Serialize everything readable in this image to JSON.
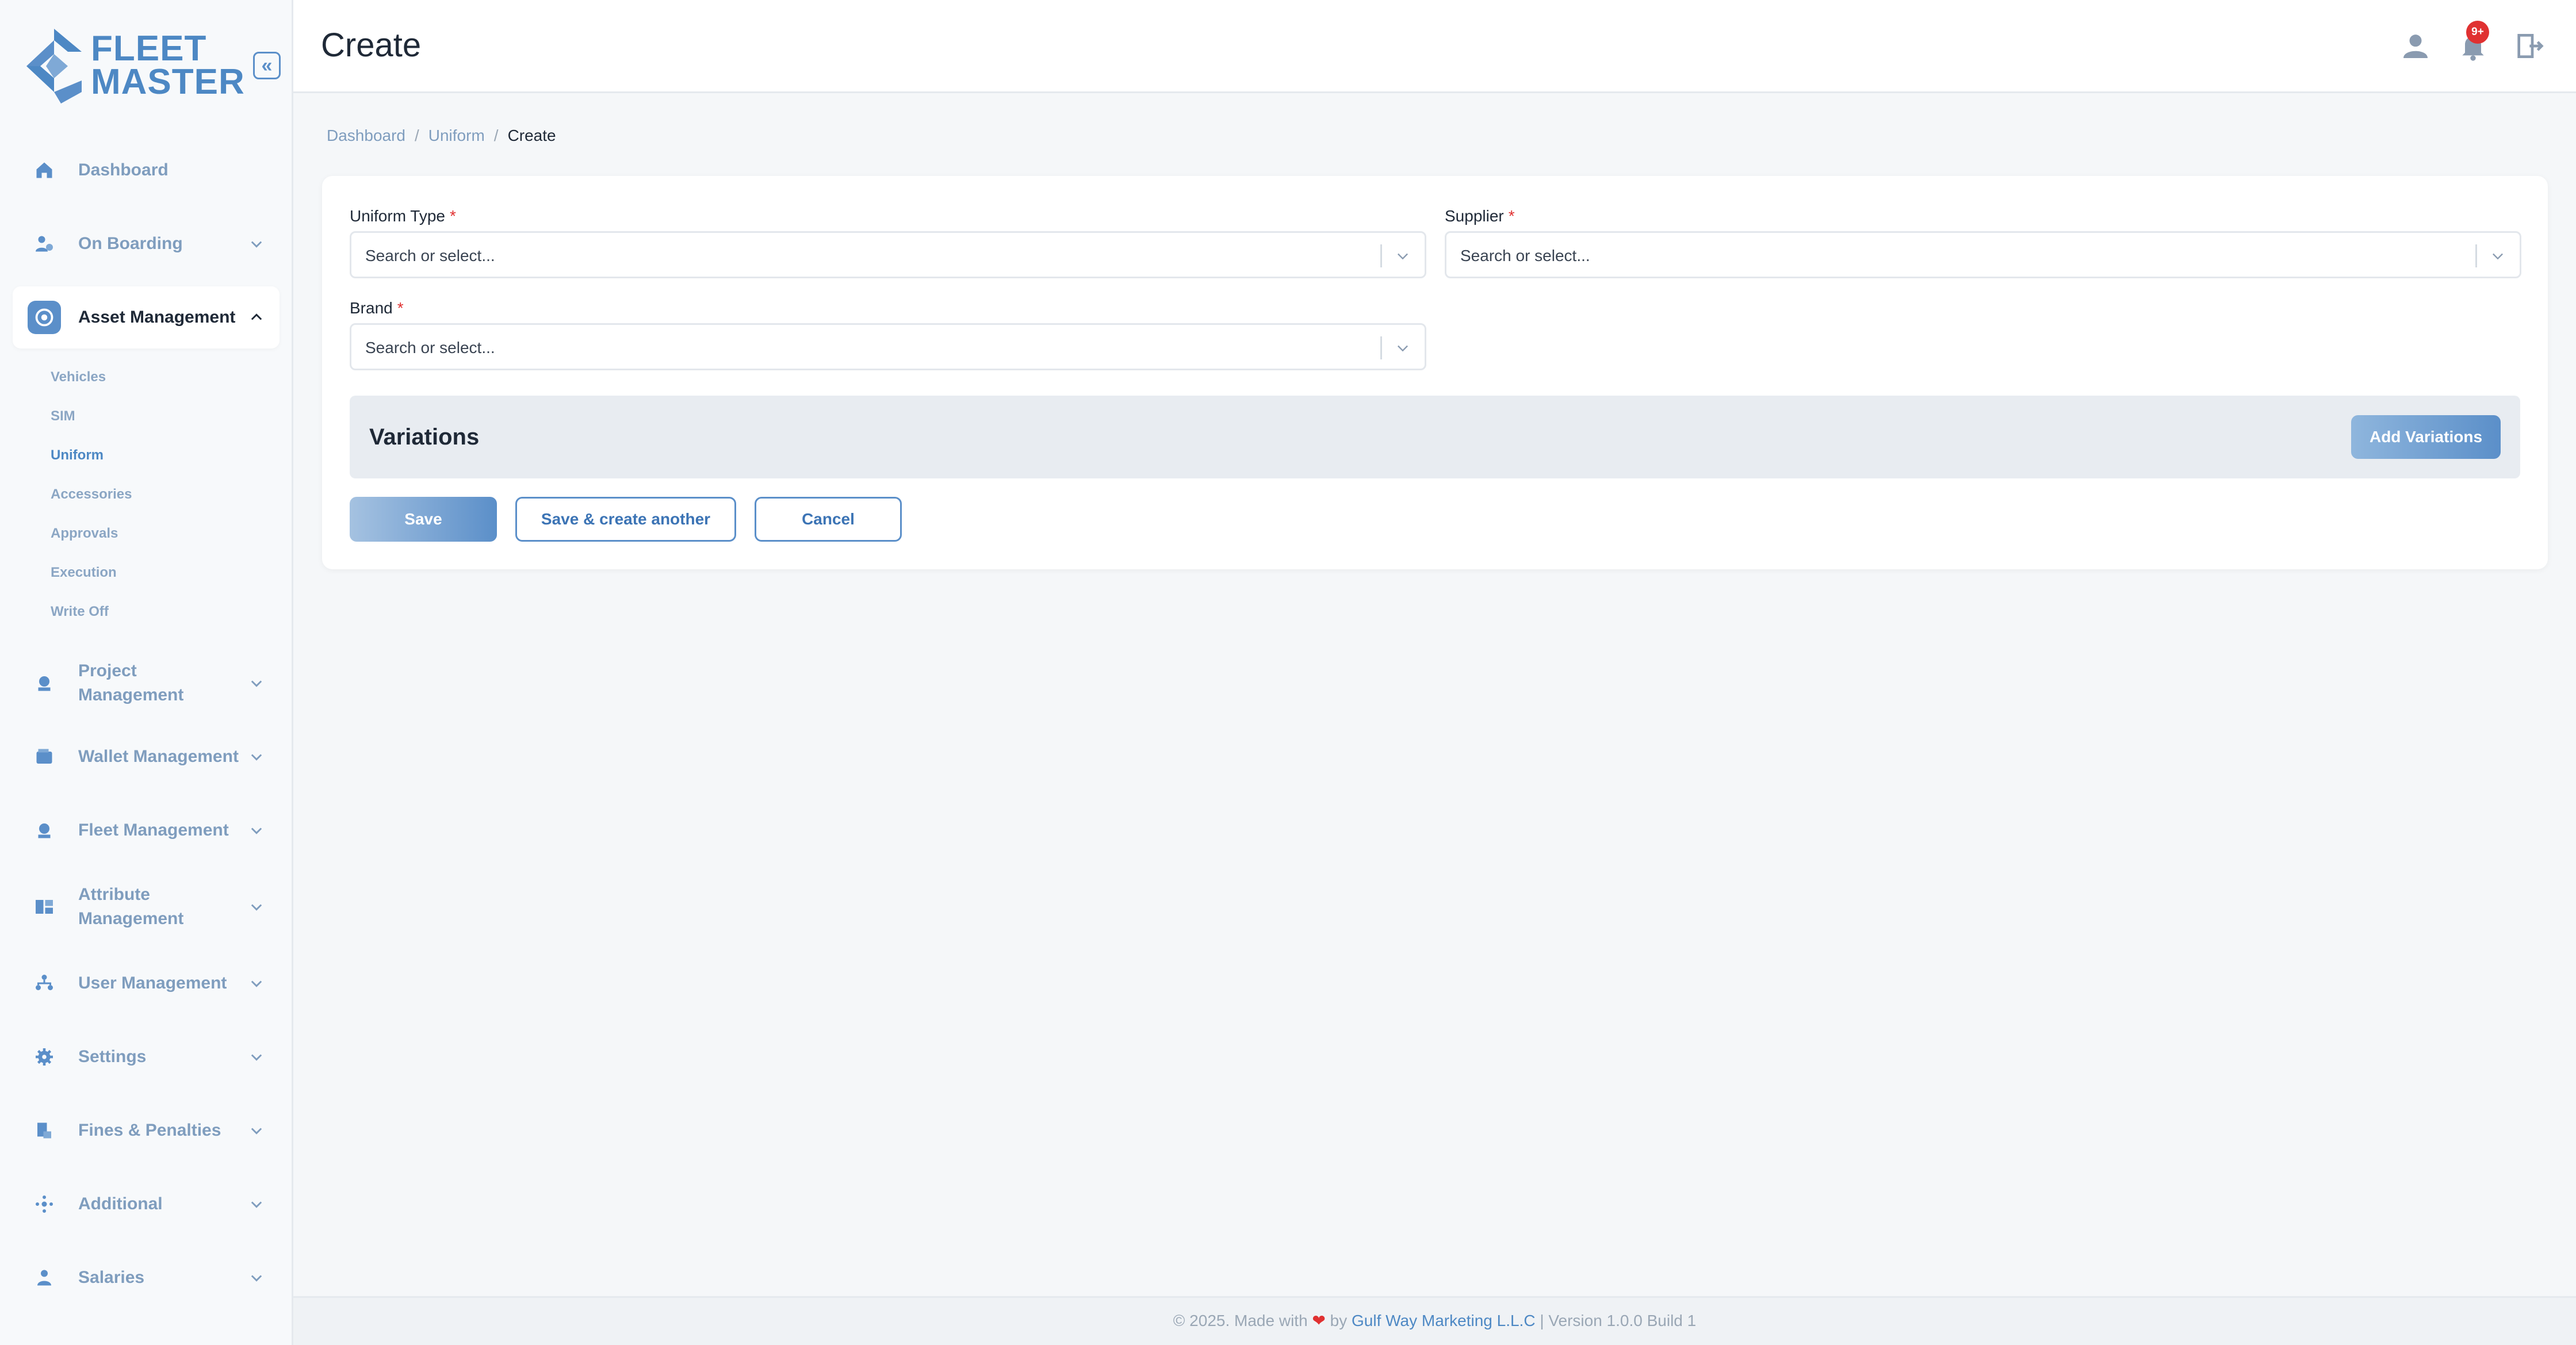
{
  "brand": {
    "line1": "FLEET",
    "line2": "MASTER"
  },
  "header": {
    "title": "Create",
    "notification_count": "9+"
  },
  "sidebar": {
    "items": [
      {
        "label": "Dashboard",
        "icon": "home-icon"
      },
      {
        "label": "On Boarding",
        "icon": "onboarding-icon"
      },
      {
        "label": "Asset Management",
        "icon": "asset-icon"
      },
      {
        "label": "Project Management",
        "icon": "project-icon"
      },
      {
        "label": "Wallet Management",
        "icon": "wallet-icon"
      },
      {
        "label": "Fleet Management",
        "icon": "fleet-icon"
      },
      {
        "label": "Attribute Management",
        "icon": "attribute-icon"
      },
      {
        "label": "User Management",
        "icon": "users-icon"
      },
      {
        "label": "Settings",
        "icon": "gear-icon"
      },
      {
        "label": "Fines & Penalties",
        "icon": "fines-icon"
      },
      {
        "label": "Additional",
        "icon": "additional-icon"
      },
      {
        "label": "Salaries",
        "icon": "salaries-icon"
      }
    ],
    "asset_sub": [
      "Vehicles",
      "SIM",
      "Uniform",
      "Accessories",
      "Approvals",
      "Execution",
      "Write Off"
    ]
  },
  "breadcrumb": {
    "items": [
      "Dashboard",
      "Uniform"
    ],
    "current": "Create",
    "separator": "/"
  },
  "form": {
    "uniform_type": {
      "label": "Uniform Type",
      "placeholder": "Search or select...",
      "required": "*"
    },
    "supplier": {
      "label": "Supplier",
      "placeholder": "Search or select...",
      "required": "*"
    },
    "brand": {
      "label": "Brand",
      "placeholder": "Search or select...",
      "required": "*"
    },
    "variations_title": "Variations",
    "add_variations": "Add Variations",
    "save": "Save",
    "save_another": "Save & create another",
    "cancel": "Cancel"
  },
  "footer": {
    "prefix": "© 2025. Made with",
    "by": "by",
    "company": "Gulf Way Marketing L.L.C",
    "suffix": "| Version 1.0.0 Build 1"
  },
  "colors": {
    "accent": "#5b8fc9",
    "danger": "#e03131",
    "muted": "#7f9dbe"
  }
}
